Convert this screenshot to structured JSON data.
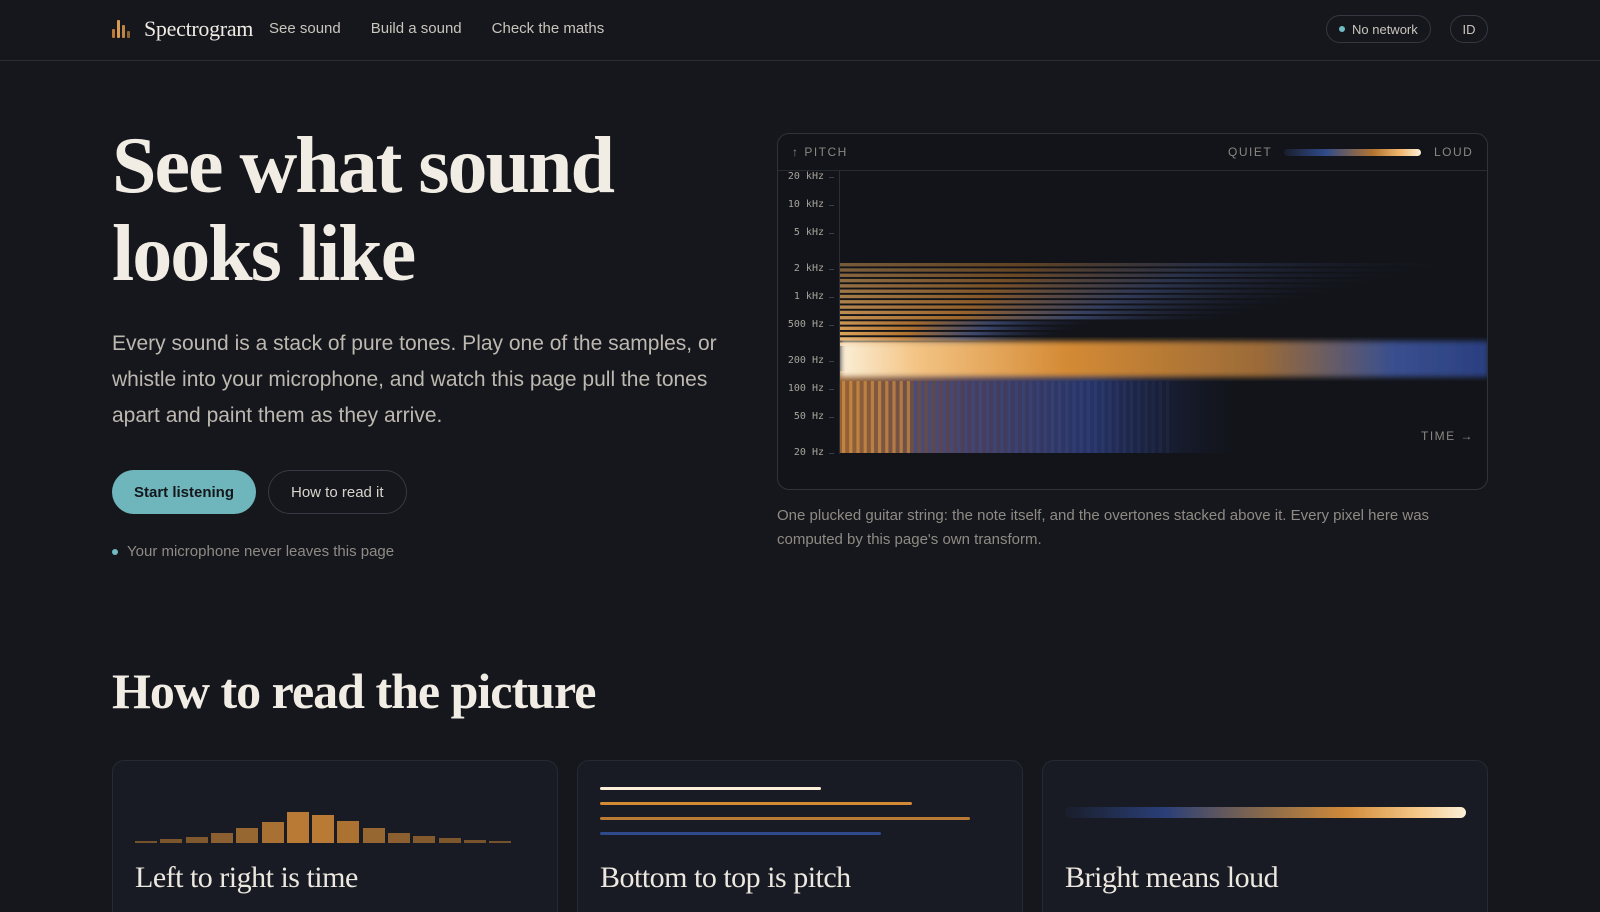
{
  "header": {
    "brand": "Spectrogram",
    "nav": [
      "See sound",
      "Build a sound",
      "Check the maths"
    ],
    "status": "No network",
    "lang": "ID"
  },
  "hero": {
    "title_line1": "See what sound",
    "title_line2": "looks like",
    "subtitle": "Every sound is a stack of pure tones. Play one of the samples, or whistle into your microphone, and watch this page pull the tones apart and paint them as they arrive.",
    "primary_button": "Start listening",
    "secondary_button": "How to read it",
    "privacy_note": "Your microphone never leaves this page"
  },
  "spectrogram": {
    "pitch_label": "↑ PITCH",
    "quiet_label": "QUIET",
    "loud_label": "LOUD",
    "time_label": "TIME →",
    "ticks": [
      "20 kHz",
      "10 kHz",
      "5 kHz",
      "2 kHz",
      "1 kHz",
      "500 Hz",
      "200 Hz",
      "100 Hz",
      "50 Hz",
      "20 Hz"
    ],
    "caption": "One plucked guitar string: the note itself, and the overtones stacked above it. Every pixel here was computed by this page's own transform."
  },
  "colors": {
    "accent": "#6fb6bc",
    "warm": "#b87a34",
    "bright": "#fbefd8",
    "cool": "#2f4a8a"
  },
  "read_section": {
    "title": "How to read the picture",
    "cards": [
      {
        "title": "Left to right is time"
      },
      {
        "title": "Bottom to top is pitch"
      },
      {
        "title": "Bright means loud"
      }
    ]
  }
}
